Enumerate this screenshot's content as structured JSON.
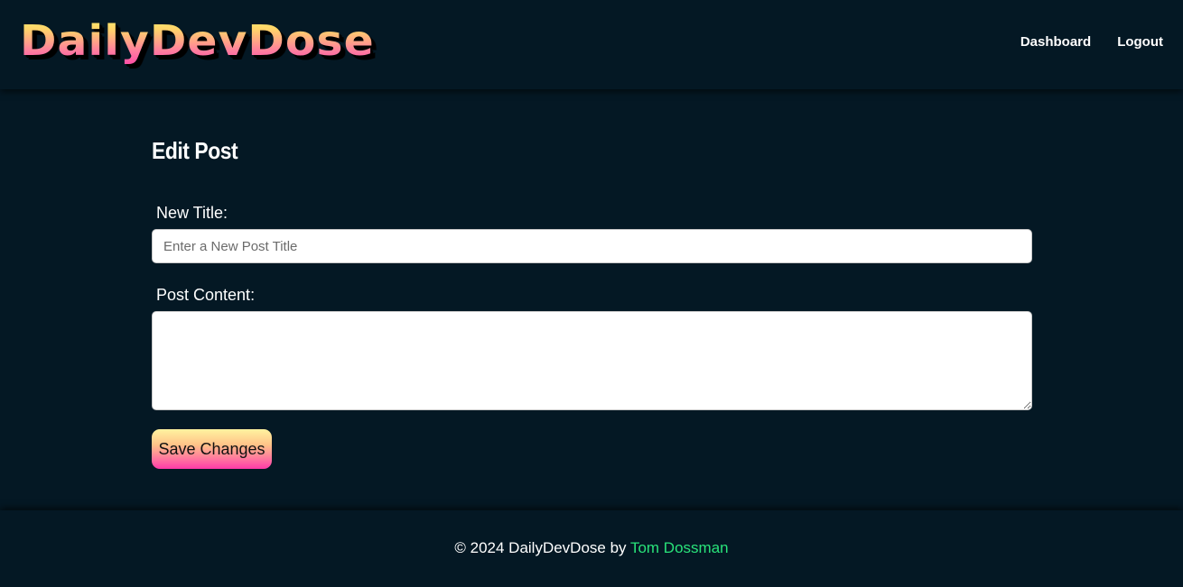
{
  "header": {
    "logo_text": "DailyDevDose",
    "nav": [
      {
        "label": "Dashboard"
      },
      {
        "label": "Logout"
      }
    ]
  },
  "main": {
    "page_title": "Edit Post",
    "title_field": {
      "label": "New Title:",
      "placeholder": "Enter a New Post Title",
      "value": ""
    },
    "content_field": {
      "label": "Post Content:",
      "value": ""
    },
    "save_label": "Save Changes"
  },
  "footer": {
    "prefix": "© 2024 DailyDevDose by ",
    "author": "Tom Dossman"
  },
  "colors": {
    "background": "#041824",
    "accent_link": "#29e37a",
    "button_gradient": [
      "#fff3a0",
      "#ff3aa8"
    ]
  }
}
